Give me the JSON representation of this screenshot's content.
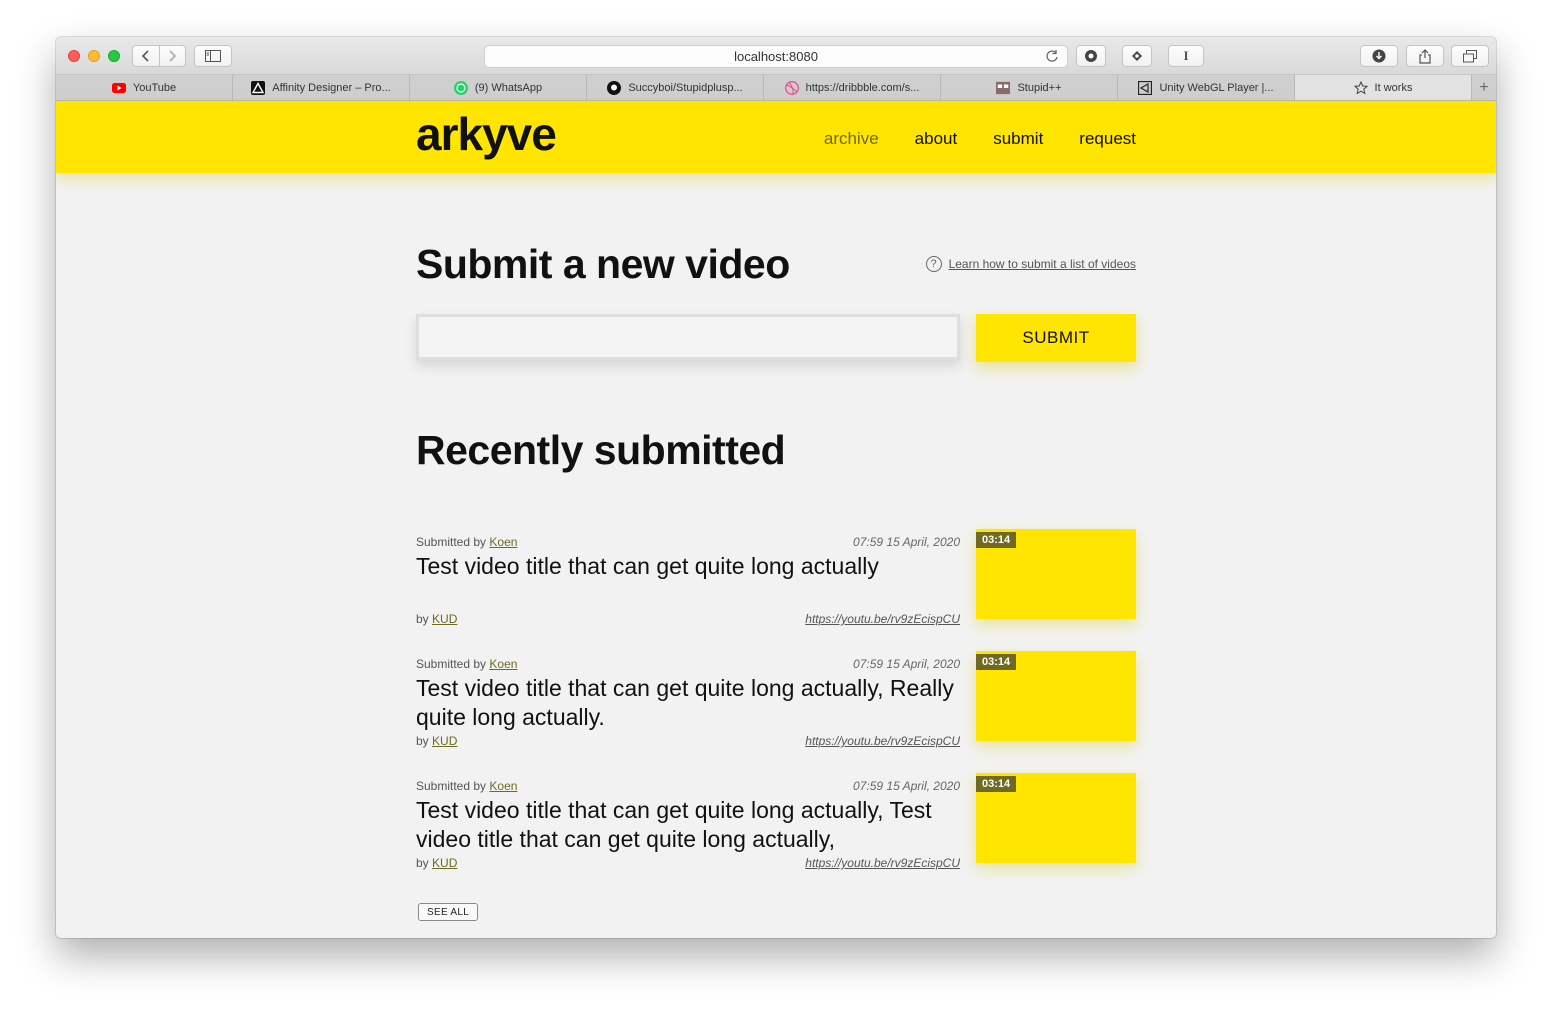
{
  "browser": {
    "address": "localhost:8080",
    "tabs": [
      {
        "label": "YouTube",
        "icon": "youtube-icon"
      },
      {
        "label": "Affinity Designer – Pro...",
        "icon": "affinity-icon"
      },
      {
        "label": "(9) WhatsApp",
        "icon": "whatsapp-icon"
      },
      {
        "label": "Succyboi/Stupidplusp...",
        "icon": "github-icon"
      },
      {
        "label": "https://dribbble.com/s...",
        "icon": "dribbble-icon"
      },
      {
        "label": "Stupid++",
        "icon": "stupidpp-icon"
      },
      {
        "label": "Unity WebGL Player |...",
        "icon": "unity-icon"
      },
      {
        "label": "It works",
        "icon": "star-icon"
      }
    ]
  },
  "site": {
    "logo": "arkyve",
    "nav": [
      {
        "label": "archive"
      },
      {
        "label": "about"
      },
      {
        "label": "submit"
      },
      {
        "label": "request"
      }
    ],
    "accent_color": "#ffe500"
  },
  "submit_section": {
    "heading": "Submit a new video",
    "help_link": "Learn how to submit a list of videos",
    "input_value": "",
    "button_label": "SUBMIT"
  },
  "recent": {
    "heading": "Recently submitted",
    "items": [
      {
        "submitted_prefix": "Submitted by",
        "submitter": "Koen",
        "date": "07:59 15 April, 2020",
        "title": "Test video title that can get quite long actually",
        "by_prefix": "by",
        "author": "KUD",
        "link": "https://youtu.be/rv9zEcispCU",
        "duration": "03:14"
      },
      {
        "submitted_prefix": "Submitted by",
        "submitter": "Koen",
        "date": "07:59 15 April, 2020",
        "title": "Test video title that can get quite long actually, Really quite long actually.",
        "by_prefix": "by",
        "author": "KUD",
        "link": "https://youtu.be/rv9zEcispCU",
        "duration": "03:14"
      },
      {
        "submitted_prefix": "Submitted by",
        "submitter": "Koen",
        "date": "07:59 15 April, 2020",
        "title": "Test video title that can get quite long actually, Test video title that can get quite long actually,",
        "by_prefix": "by",
        "author": "KUD",
        "link": "https://youtu.be/rv9zEcispCU",
        "duration": "03:14"
      }
    ],
    "see_all_label": "SEE ALL"
  }
}
